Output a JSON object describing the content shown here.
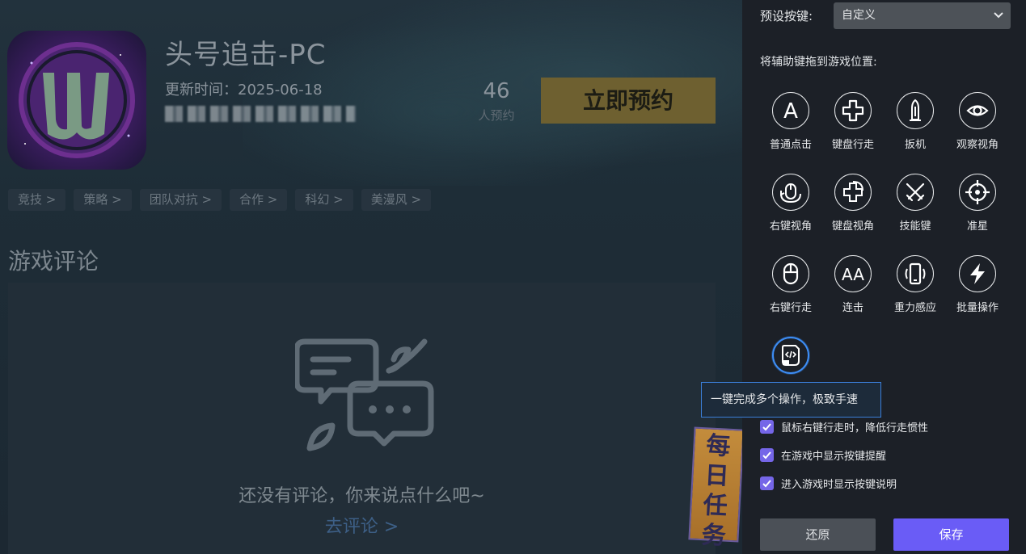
{
  "game": {
    "title": "头号追击-PC",
    "update_time": "更新时间：2025-06-18",
    "reserve_count": "46",
    "reserve_label": "人预约",
    "reserve_button": "立即预约",
    "tags": [
      "竞技 >",
      "策略 >",
      "团队对抗 >",
      "合作 >",
      "科幻 >",
      "美漫风 >"
    ],
    "comments_title": "游戏评论",
    "empty_comment_text": "还没有评论，你来说点什么吧~",
    "go_comment_link": "去评论 >"
  },
  "daily_task": {
    "chars": [
      "每",
      "日",
      "任",
      "务"
    ]
  },
  "panel": {
    "preset_label": "预设按键:",
    "preset_value": "自定义",
    "drag_hint": "将辅助键拖到游戏位置:",
    "keys": [
      {
        "label": "普通点击",
        "icon": "letter-a-icon"
      },
      {
        "label": "键盘行走",
        "icon": "dpad-icon"
      },
      {
        "label": "扳机",
        "icon": "bullet-icon"
      },
      {
        "label": "观察视角",
        "icon": "eye-icon"
      },
      {
        "label": "右键视角",
        "icon": "mouse-rotate-icon"
      },
      {
        "label": "键盘视角",
        "icon": "keyboard-rotate-icon"
      },
      {
        "label": "技能键",
        "icon": "crossed-swords-icon"
      },
      {
        "label": "准星",
        "icon": "crosshair-icon"
      },
      {
        "label": "右键行走",
        "icon": "mouse-icon"
      },
      {
        "label": "连击",
        "icon": "double-a-icon"
      },
      {
        "label": "重力感应",
        "icon": "phone-shake-icon"
      },
      {
        "label": "批量操作",
        "icon": "lightning-icon"
      },
      {
        "label": "",
        "icon": "script-icon"
      }
    ],
    "tooltip": "一键完成多个操作，极致手速",
    "options": [
      {
        "label": "鼠标右键行走时，降低行走惯性",
        "checked": true
      },
      {
        "label": "在游戏中显示按键提醒",
        "checked": true
      },
      {
        "label": "进入游戏时显示按键说明",
        "checked": true
      }
    ],
    "reset_button": "还原",
    "save_button": "保存",
    "accent_color": "#6a5cf6",
    "highlight_color": "#3d8ef7"
  }
}
